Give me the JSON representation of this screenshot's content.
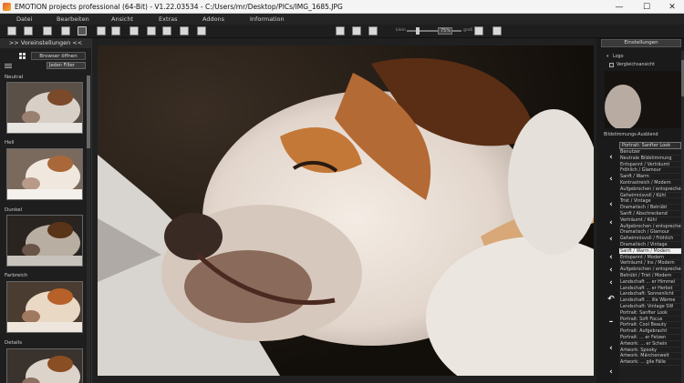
{
  "window": {
    "title": "EMOTION projects professional (64-Bit) - V1.22.03534 - C:/Users/mr/Desktop/PICs/IMG_1685.JPG",
    "minimize_icon": "—",
    "maximize_icon": "☐",
    "close_icon": "✕"
  },
  "menu": {
    "items": [
      "Datei",
      "Bearbeiten",
      "Ansicht",
      "Extras",
      "Addons",
      "Information"
    ]
  },
  "toolbar": {
    "zoom_value": "75%",
    "slider_left_label": "klein",
    "slider_right_label": "groß"
  },
  "left_panel": {
    "header": ">> Voreinstellungen <<",
    "browser_button": "Browser öffnen",
    "filter_select": "Jeden Filter",
    "presets": [
      {
        "label": "Neutral"
      },
      {
        "label": "Hell"
      },
      {
        "label": "Dunkel"
      },
      {
        "label": "Farbreich"
      },
      {
        "label": "Details"
      }
    ]
  },
  "right_panel": {
    "header": "Einstellungen",
    "logo_label": "Logo",
    "compare_label": "Vergleichsansicht",
    "mood_label": "Bildstimmungs-Ausblend",
    "look_select": "Portrait: Sanfter Look",
    "looks": [
      "Benutzer",
      "Neutrale Bildstimmung",
      "Entspannt / Verträumt",
      "Fröhlich / Glamour",
      "Sanft / Warm",
      "Kontrastreich / Modern",
      "Aufgebrochen / entsprechend",
      "Geheimnisvoll / Kühl",
      "Trist / Vintage",
      "Dramatisch / Betrübt",
      "Sanft / Abschreckend",
      "Verträumt / Kühl",
      "Aufgebrochen / entsprechend",
      "Dramatisch / Glamour",
      "Geheimnisvoll / Fröhlich",
      "Dramatisch / Vintage",
      "Sanft / Warm / Modern",
      "Entspannt / Modern",
      "Verträumt / Ins / Modern",
      "Aufgebrochen / entsprechend",
      "Betrübt / Trist / Modern",
      "Landschaft ... er Himmel",
      "Landschaft ... er Herbst",
      "Landschaft: Sonnenlicht",
      "Landschaft ... ille Wärme",
      "Landschaft: Vintage SW",
      "Portrait: Sanfter Look",
      "Portrait: Soft Focus",
      "Portrait: Cool Beauty",
      "Portrait: Aufgebracht",
      "Portrait: ... er Fetzen",
      "Artwork: ... er Schein",
      "Artwork: Spooky",
      "Artwork: Märchenwelt",
      "Artwork: ... gile Fälle"
    ],
    "selected_index": 16
  },
  "colors": {
    "accent": "#e8e8e8",
    "panel_bg": "#1e1e1e",
    "menu_bg": "#242424"
  }
}
